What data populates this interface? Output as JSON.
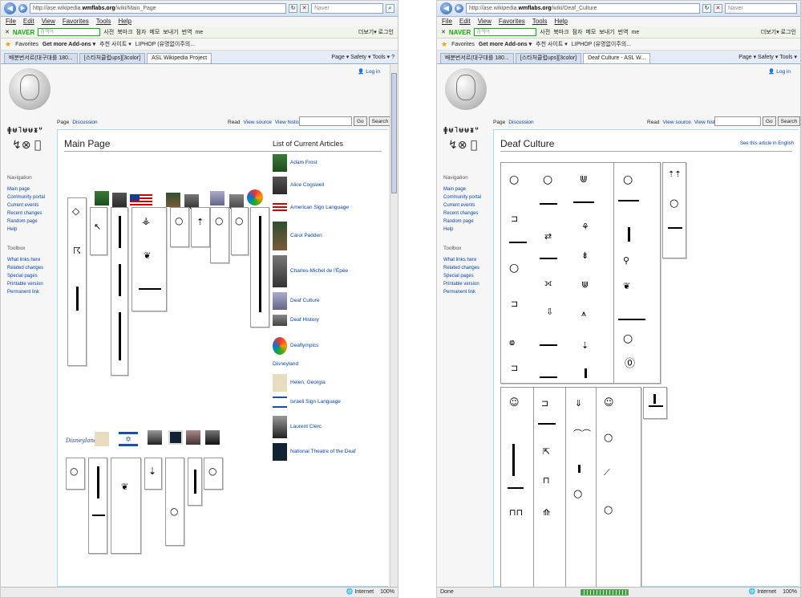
{
  "browser": {
    "menu": [
      "File",
      "Edit",
      "View",
      "Favorites",
      "Tools",
      "Help"
    ],
    "naver": {
      "logo": "NAVER",
      "search_placeholder": "검색어",
      "links": [
        "사전",
        "북마크",
        "점자",
        "메모",
        "보내기",
        "번역",
        "me"
      ],
      "right": "더보기▾ 로그인"
    },
    "favorites": {
      "label": "Favorites",
      "addons": "Get more Add-ons ▾",
      "site1": "추천 사이트 ▾",
      "site2": "LIPHOP (유명없이주의..."
    },
    "toolbar": {
      "page": "Page ▾",
      "safety": "Safety ▾",
      "tools": "Tools ▾",
      "help": "?"
    },
    "left": {
      "url_prefix": "http://ase.wikipedia.",
      "url_domain": "wmflabs.org",
      "url_path": "/wiki/Main_Page",
      "search_engine": "Naver",
      "tabs": [
        "배분번서르(대구대를 180...",
        "[스타처클럽ups][3color]",
        "ASL Wikipedia Project"
      ],
      "status_left": "",
      "status_zone": "Internet",
      "status_zoom": "100%"
    },
    "right": {
      "url_prefix": "http://ase.wikipedia.",
      "url_domain": "wmflabs.org",
      "url_path": "/wiki/Deaf_Culture",
      "search_engine": "Naver",
      "tabs": [
        "배분번서르(대구대를 180...",
        "[스타처클럽ups][3color]",
        "Deaf Culture - ASL W..."
      ],
      "status_left": "Done",
      "status_zone": "Internet",
      "status_zoom": "100%"
    }
  },
  "wiki": {
    "login": "Log in",
    "page_tabs": [
      "Page",
      "Discussion"
    ],
    "view_tabs": [
      "Read",
      "View source",
      "View history"
    ],
    "go": "Go",
    "search": "Search",
    "navigation_heading": "Navigation",
    "navigation": [
      "Main page",
      "Community portal",
      "Current events",
      "Recent changes",
      "Random page",
      "Help"
    ],
    "toolbox_heading": "Toolbox",
    "toolbox": [
      "What links here",
      "Related changes",
      "Special pages",
      "Printable version",
      "Permanent link"
    ]
  },
  "main_page": {
    "title": "Main Page",
    "list_heading": "List of Current Articles",
    "articles": [
      "Adam Frost",
      "Alice Cogswell",
      "American Sign Language",
      "Carol Padden",
      "Charles-Michel de l'Épée",
      "Deaf Culture",
      "Deaf History",
      "Deaflympics",
      "Disneyland",
      "Helen, Georgia",
      "Israeli Sign Language",
      "Laurent Clerc",
      "National Theatre of the Deaf"
    ],
    "disney_label": "Disneyland"
  },
  "deaf_culture": {
    "title": "Deaf Culture",
    "see_article": "See this article in English"
  },
  "colors": {
    "link": "#0645ad",
    "chrome": "#d6e1f0",
    "naver_green": "#19a619"
  }
}
